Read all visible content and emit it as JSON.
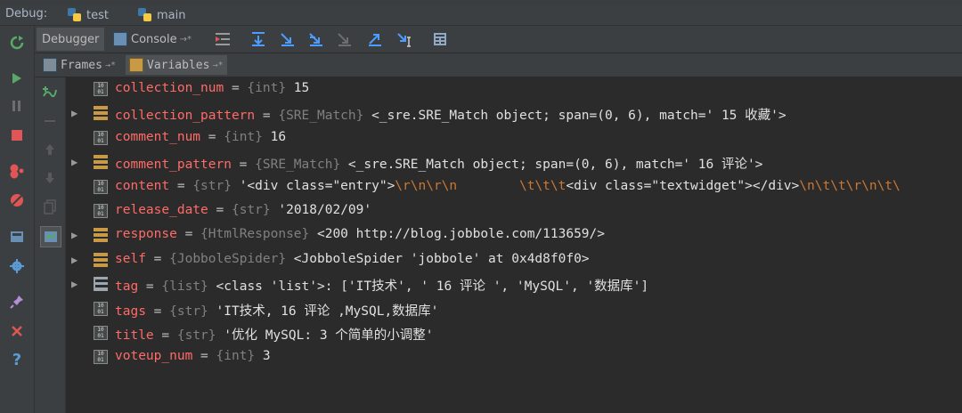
{
  "debug_bar": {
    "label": "Debug:",
    "tabs": [
      {
        "label": "test"
      },
      {
        "label": "main"
      }
    ]
  },
  "tabs": {
    "debugger": "Debugger",
    "console": "Console",
    "console_pin": "→*"
  },
  "subtabs": {
    "frames": "Frames",
    "frames_pin": "→*",
    "variables": "Variables",
    "variables_pin": "→*"
  },
  "variables": [
    {
      "name": "collection_num",
      "eq": " = ",
      "type": "{int}",
      "value": " 15",
      "icon": "num",
      "expandable": false
    },
    {
      "name": "collection_pattern",
      "eq": " = ",
      "type": "{SRE_Match}",
      "value": " <_sre.SRE_Match object; span=(0, 6), match=' 15 收藏'>",
      "icon": "obj",
      "expandable": true
    },
    {
      "name": "comment_num",
      "eq": " = ",
      "type": "{int}",
      "value": " 16",
      "icon": "num",
      "expandable": false
    },
    {
      "name": "comment_pattern",
      "eq": " = ",
      "type": "{SRE_Match}",
      "value": " <_sre.SRE_Match object; span=(0, 6), match=' 16 评论'>",
      "icon": "obj",
      "expandable": true
    },
    {
      "name": "content",
      "eq": " = ",
      "type": "{str}",
      "value_parts": [
        {
          "t": " '<div class=\"entry\">",
          "esc": false
        },
        {
          "t": "\\r\\n\\r\\n",
          "esc": true
        },
        {
          "t": "        ",
          "esc": false
        },
        {
          "t": "\\t\\t\\t",
          "esc": true
        },
        {
          "t": "<div class=\"textwidget\"></div>",
          "esc": false
        },
        {
          "t": "\\n\\t\\t\\r\\n\\t\\",
          "esc": true
        }
      ],
      "icon": "num",
      "expandable": false
    },
    {
      "name": "release_date",
      "eq": " = ",
      "type": "{str}",
      "value": " '2018/02/09'",
      "icon": "num",
      "expandable": false
    },
    {
      "name": "response",
      "eq": " = ",
      "type": "{HtmlResponse}",
      "value": " <200 http://blog.jobbole.com/113659/>",
      "icon": "obj",
      "expandable": true
    },
    {
      "name": "self",
      "eq": " = ",
      "type": "{JobboleSpider}",
      "value": " <JobboleSpider 'jobbole' at 0x4d8f0f0>",
      "icon": "obj",
      "expandable": true
    },
    {
      "name": "tag",
      "eq": " = ",
      "type": "{list}",
      "value": " <class 'list'>: ['IT技术', ' 16 评论 ', 'MySQL', '数据库']",
      "icon": "list",
      "expandable": true
    },
    {
      "name": "tags",
      "eq": " = ",
      "type": "{str}",
      "value": " 'IT技术, 16 评论 ,MySQL,数据库'",
      "icon": "num",
      "expandable": false
    },
    {
      "name": "title",
      "eq": " = ",
      "type": "{str}",
      "value": " '优化 MySQL: 3 个简单的小调整'",
      "icon": "num",
      "expandable": false
    },
    {
      "name": "voteup_num",
      "eq": " = ",
      "type": "{int}",
      "value": " 3",
      "icon": "num",
      "expandable": false
    }
  ],
  "icons": {
    "num_icon_text": "10\n01",
    "colors": {
      "var_name": "#ff6b68",
      "type": "#808080",
      "escape": "#cc7832",
      "value": "#e0e0e0"
    }
  }
}
